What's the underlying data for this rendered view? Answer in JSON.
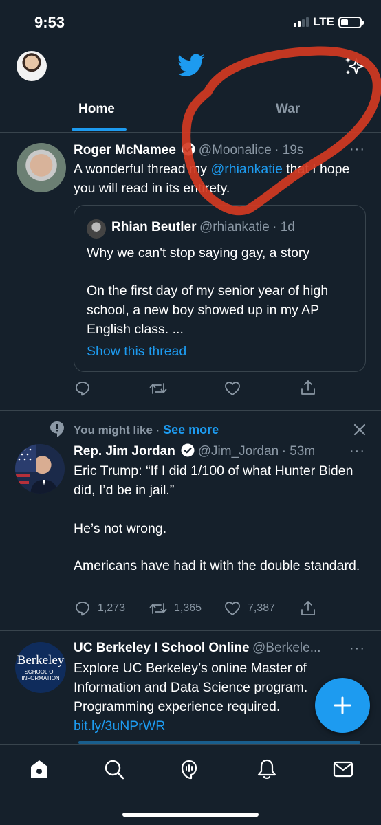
{
  "status": {
    "time": "9:53",
    "network": "LTE"
  },
  "tabs": {
    "home": "Home",
    "war": "War"
  },
  "tweet1": {
    "name": "Roger McNamee",
    "handle": "@Moonalice",
    "time": "· 19s",
    "more": "···",
    "text_before": "A wonderful thread my ",
    "mention": "@rhiankatie",
    "text_after": " that I hope you will read in its entirety.",
    "quote": {
      "name": "Rhian Beutler",
      "handle": "@rhiankatie",
      "time": "· 1d",
      "line1": "Why we can't stop saying gay, a story",
      "line2": "On the first day of my senior year of high school, a new boy showed up in my AP English class. ...",
      "show_thread": "Show this thread"
    }
  },
  "suggestion": {
    "label": "You might like",
    "sep": "·",
    "see_more": "See more"
  },
  "tweet2": {
    "name": "Rep. Jim Jordan",
    "handle": "@Jim_Jordan",
    "time": "· 53m",
    "more": "···",
    "p1": "Eric Trump: “If I did 1/100 of what Hunter Biden did, I’d be in jail.”",
    "p2": "He’s not wrong.",
    "p3": "Americans have had it with the double standard.",
    "replies": "1,273",
    "retweets": "1,365",
    "likes": "7,387"
  },
  "tweet3": {
    "name": "UC Berkeley I School Online",
    "handle": "@Berkele...",
    "more": "···",
    "text": "Explore UC Berkeley’s online Master of Information and Data Science program. Programming experience required. ",
    "link": "bit.ly/3uNPrWR",
    "avatar_word": "Berkeley",
    "avatar_sub": "SCHOOL OF INFORMATION"
  },
  "colors": {
    "background": "#15202b",
    "accent": "#1d9bf0",
    "muted": "#8b98a5",
    "annotation": "#d23a22"
  }
}
